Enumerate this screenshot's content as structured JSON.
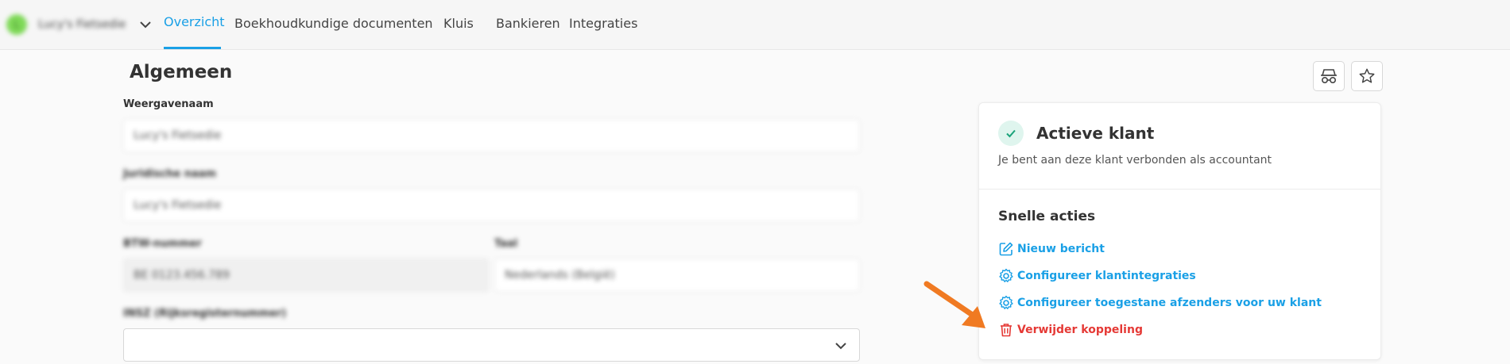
{
  "nav": {
    "client_initial": "L",
    "client_name": "Lucy's Fietsedie",
    "items": [
      {
        "label": "Overzicht",
        "active": true
      },
      {
        "label": "Boekhoudkundige documenten",
        "active": false
      },
      {
        "label": "Kluis",
        "active": false
      },
      {
        "label": "Bankieren",
        "active": false
      },
      {
        "label": "Integraties",
        "active": false
      }
    ],
    "accent_color": "#1aa0e6"
  },
  "main": {
    "title": "Algemeen",
    "fields": {
      "display_name": {
        "label": "Weergavenaam",
        "value": "Lucy's Fietsedie"
      },
      "legal_name": {
        "label": "Juridische naam",
        "value": "Lucy's Fietsedie"
      },
      "vat": {
        "label": "BTW-nummer",
        "value": "BE 0123.456.789"
      },
      "language": {
        "label": "Taal",
        "value": "Nederlands (België)"
      },
      "ssn": {
        "label": "INSZ (Rijksregisternummer)",
        "value": ""
      }
    },
    "header_icons": [
      "incognito-icon",
      "star-icon"
    ]
  },
  "card": {
    "status_title": "Actieve klant",
    "status_subtitle": "Je bent aan deze klant verbonden als accountant",
    "quick_actions_title": "Snelle acties",
    "actions": [
      {
        "label": "Nieuw bericht",
        "icon": "edit-icon",
        "color": "#1aa0e6"
      },
      {
        "label": "Configureer klantintegraties",
        "icon": "gear-icon",
        "color": "#1aa0e6"
      },
      {
        "label": "Configureer toegestane afzenders voor uw klant",
        "icon": "gear-icon",
        "color": "#1aa0e6"
      },
      {
        "label": "Verwijder koppeling",
        "icon": "trash-icon",
        "color": "#e53935"
      }
    ]
  }
}
